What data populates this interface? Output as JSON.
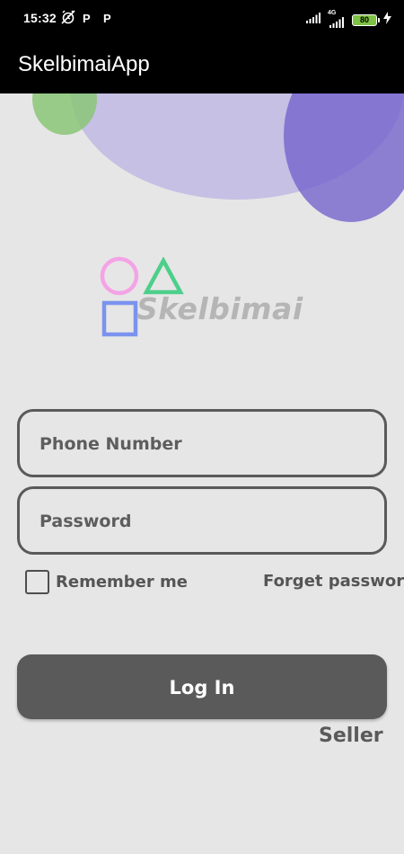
{
  "status_bar": {
    "time": "15:32",
    "p_icon_1": "P",
    "p_icon_2": "P",
    "network_type": "4G",
    "battery_level": "80",
    "icons": [
      "alarm-off-icon",
      "parking-icon",
      "parking-icon",
      "signal-icon",
      "signal-4g-icon",
      "battery-icon",
      "charging-icon"
    ]
  },
  "app_bar": {
    "title": "SkelbimaiApp"
  },
  "logo": {
    "text": "Skelbimai",
    "colors": {
      "circle": "#f4a3e6",
      "triangle": "#4ccf8a",
      "square": "#7b93ee"
    }
  },
  "form": {
    "phone_placeholder": "Phone Number",
    "password_placeholder": "Password",
    "remember_label": "Remember me",
    "remember_checked": false,
    "forget_label": "Forget password",
    "login_label": "Log In",
    "seller_label": "Seller"
  },
  "colors": {
    "background": "#e6e6e6",
    "app_bar": "#000000",
    "button": "#5a5a5a",
    "blob_lilac": "#aca4e2",
    "blob_violet": "#7262cc",
    "blob_green": "#86c470"
  }
}
